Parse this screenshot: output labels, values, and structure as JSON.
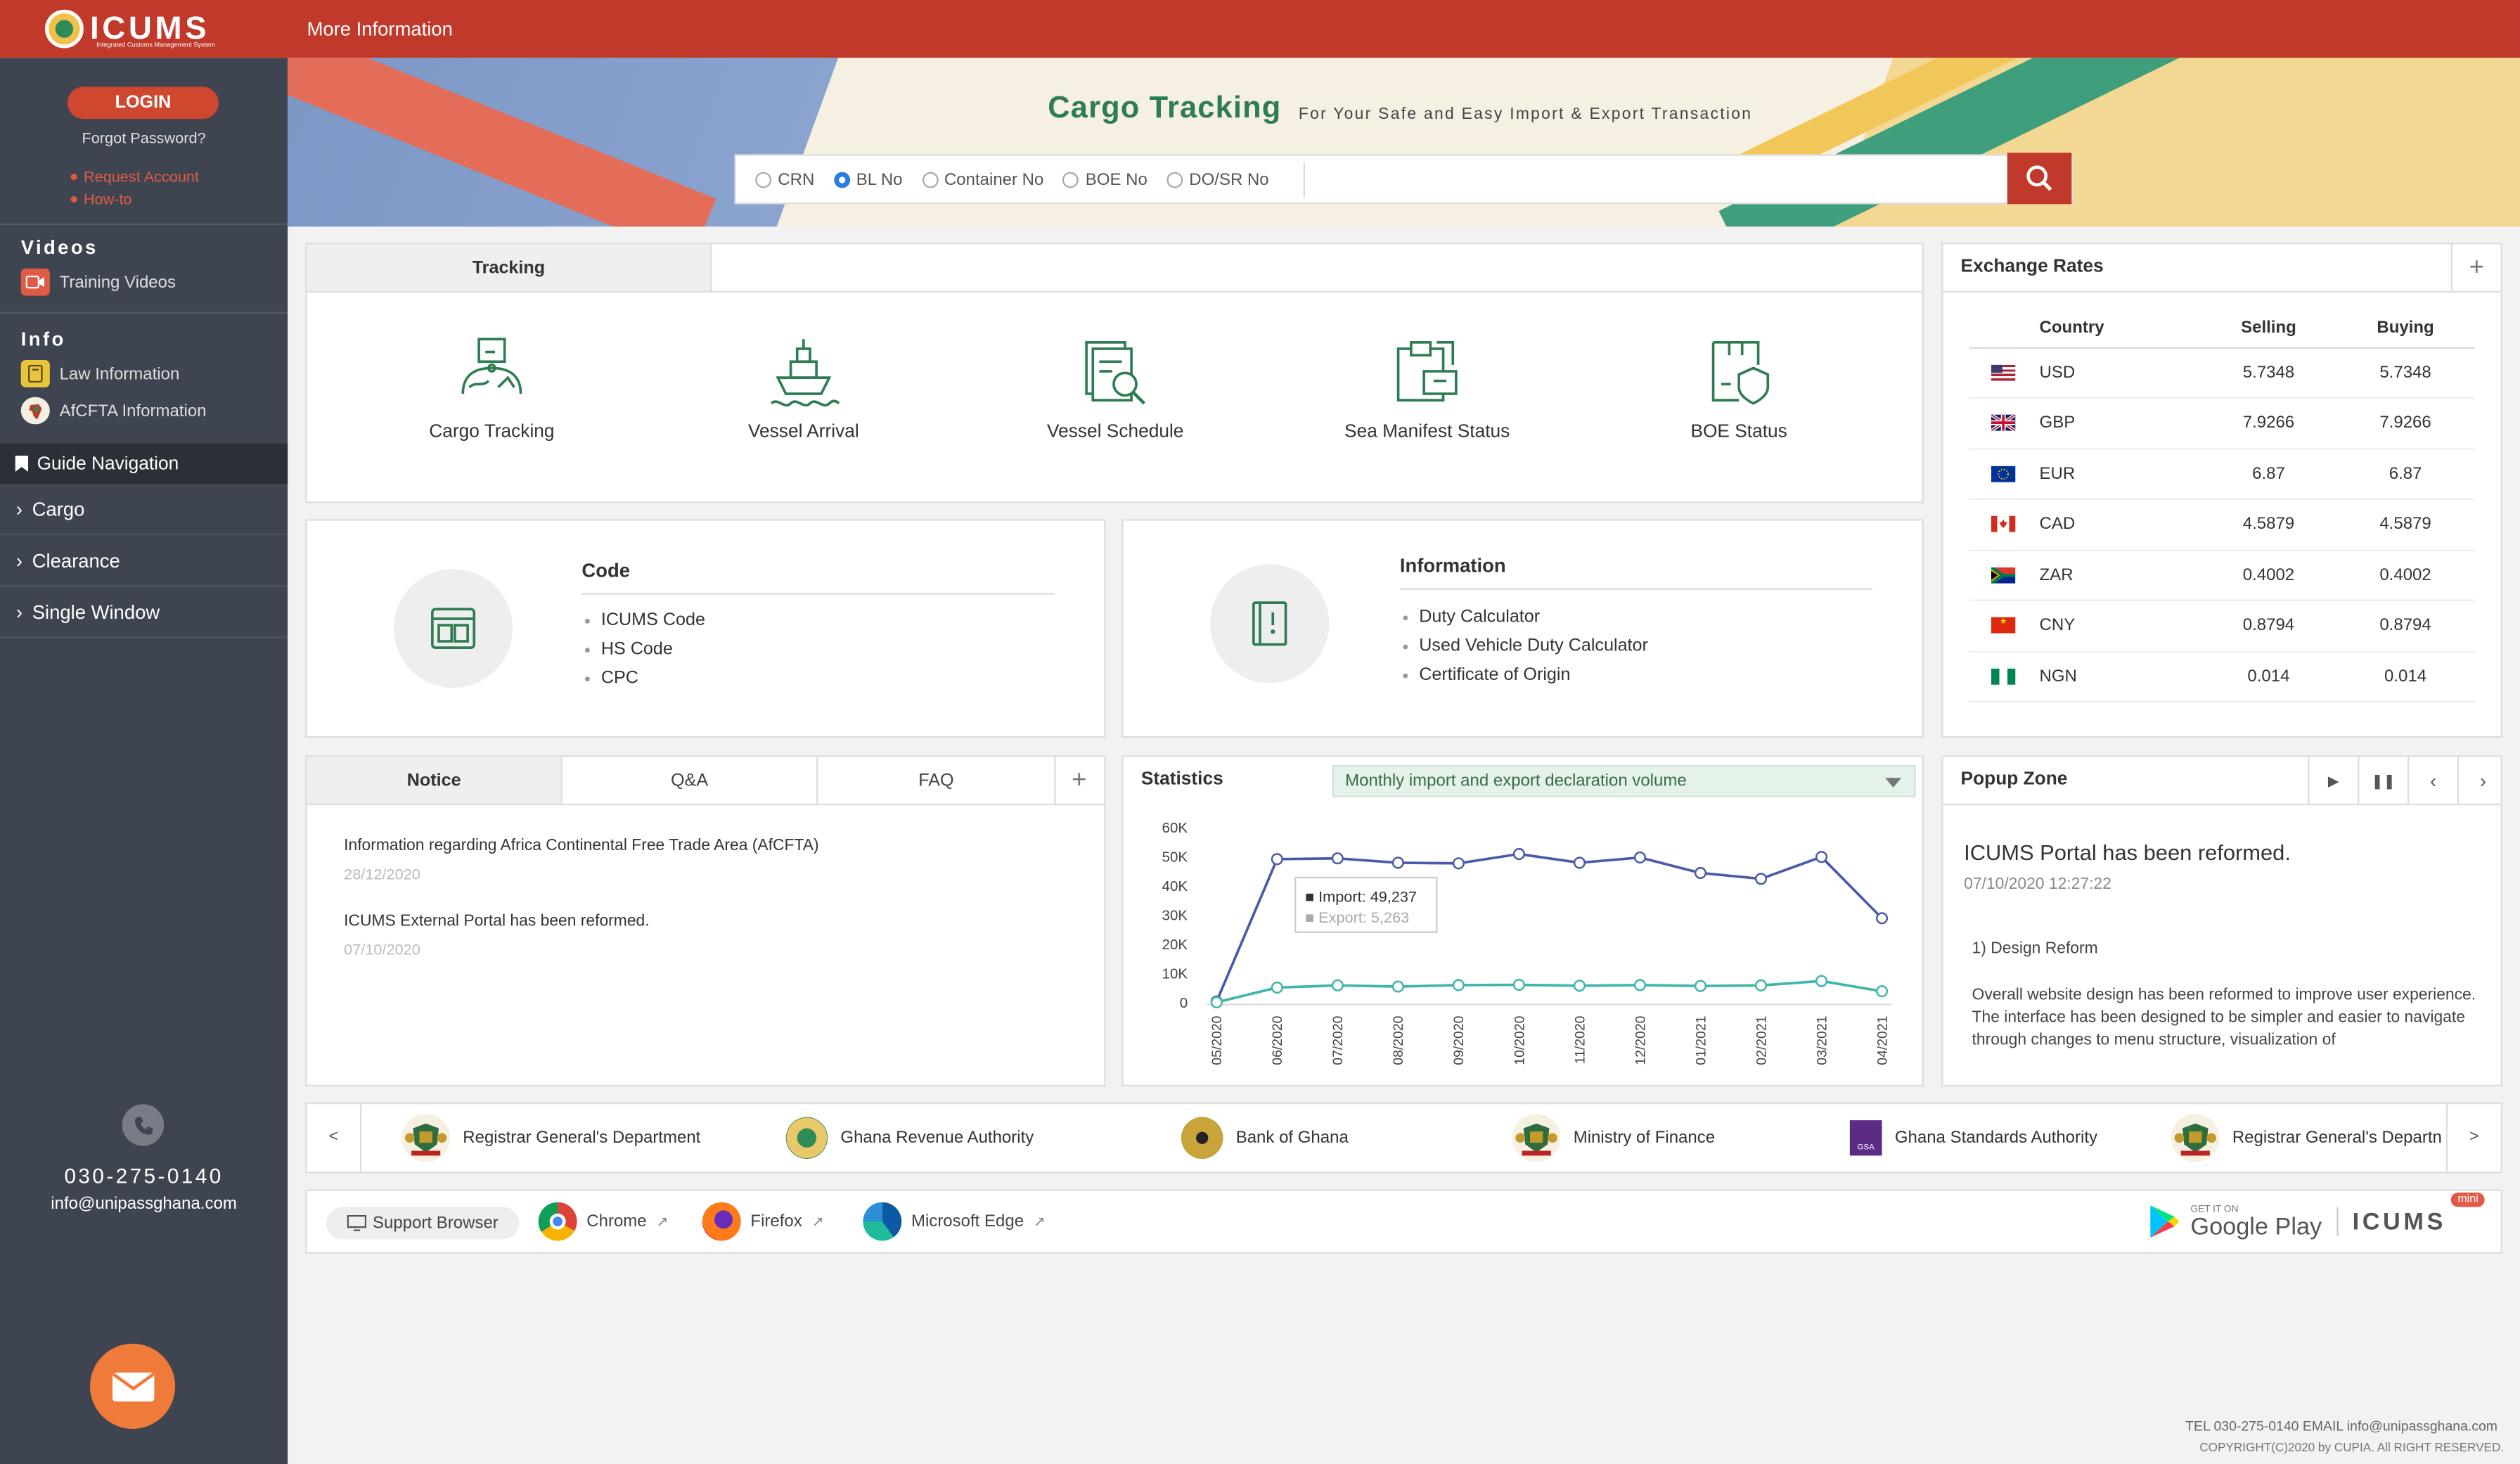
{
  "header": {
    "logo_text": "ICUMS",
    "logo_sub": "Integrated Customs Management System",
    "more_info": "More Information"
  },
  "sidebar": {
    "login": "LOGIN",
    "forgot": "Forgot Password?",
    "links": [
      "Request Account",
      "How-to"
    ],
    "videos_head": "Videos",
    "videos_items": [
      "Training Videos"
    ],
    "info_head": "Info",
    "info_items": [
      "Law Information",
      "AfCFTA Information"
    ],
    "guide": "Guide Navigation",
    "nav": [
      "Cargo",
      "Clearance",
      "Single Window"
    ],
    "phone": "030-275-0140",
    "email": "info@unipassghana.com"
  },
  "banner": {
    "title": "Cargo Tracking",
    "subtitle": "For Your Safe and Easy Import & Export Transaction",
    "radios": [
      "CRN",
      "BL No",
      "Container No",
      "BOE No",
      "DO/SR No"
    ],
    "selected": "BL No"
  },
  "tracking": {
    "tab": "Tracking",
    "items": [
      "Cargo Tracking",
      "Vessel Arrival",
      "Vessel Schedule",
      "Sea Manifest Status",
      "BOE Status"
    ]
  },
  "code": {
    "title": "Code",
    "items": [
      "ICUMS Code",
      "HS Code",
      "CPC"
    ]
  },
  "information": {
    "title": "Information",
    "items": [
      "Duty Calculator",
      "Used Vehicle Duty Calculator",
      "Certificate of Origin"
    ]
  },
  "exchange": {
    "title": "Exchange Rates",
    "headers": [
      "Country",
      "Selling",
      "Buying"
    ],
    "rows": [
      {
        "code": "USD",
        "selling": "5.7348",
        "buying": "5.7348"
      },
      {
        "code": "GBP",
        "selling": "7.9266",
        "buying": "7.9266"
      },
      {
        "code": "EUR",
        "selling": "6.87",
        "buying": "6.87"
      },
      {
        "code": "CAD",
        "selling": "4.5879",
        "buying": "4.5879"
      },
      {
        "code": "ZAR",
        "selling": "0.4002",
        "buying": "0.4002"
      },
      {
        "code": "CNY",
        "selling": "0.8794",
        "buying": "0.8794"
      },
      {
        "code": "NGN",
        "selling": "0.014",
        "buying": "0.014"
      }
    ]
  },
  "notice": {
    "tabs": [
      "Notice",
      "Q&A",
      "FAQ"
    ],
    "items": [
      {
        "title": "Information regarding Africa Continental Free Trade Area (AfCFTA)",
        "date": "28/12/2020"
      },
      {
        "title": "ICUMS External Portal has been reformed.",
        "date": "07/10/2020"
      }
    ]
  },
  "statistics": {
    "title": "Statistics",
    "select": "Monthly import and export declaration volume",
    "tooltip_import": "Import: 49,237",
    "tooltip_export": "Export: 5,263"
  },
  "chart_data": {
    "type": "line",
    "x": [
      "05/2020",
      "06/2020",
      "07/2020",
      "08/2020",
      "09/2020",
      "10/2020",
      "11/2020",
      "12/2020",
      "01/2021",
      "02/2021",
      "03/2021",
      "04/2021"
    ],
    "series": [
      {
        "name": "Import",
        "values": [
          500,
          49237,
          49500,
          48000,
          47800,
          51000,
          48000,
          49800,
          44500,
          42500,
          50000,
          29000
        ],
        "color": "#4a5aa8"
      },
      {
        "name": "Export",
        "values": [
          200,
          5263,
          6000,
          5600,
          6100,
          6200,
          5900,
          6100,
          5800,
          6000,
          7500,
          4000
        ],
        "color": "#3fb6a8"
      }
    ],
    "yticks": [
      "60K",
      "50K",
      "40K",
      "30K",
      "20K",
      "10K",
      "0"
    ],
    "ylim": [
      0,
      60000
    ]
  },
  "popup": {
    "title": "Popup Zone",
    "heading": "ICUMS Portal has been reformed.",
    "date": "07/10/2020 12:27:22",
    "section": "1) Design Reform",
    "body": "Overall website design has been reformed to improve user experience. The interface has been designed to be simpler and easier to navigate through changes to menu structure, visualization of"
  },
  "partners": [
    "Registrar General's Department",
    "Ghana Revenue Authority",
    "Bank of Ghana",
    "Ministry of Finance",
    "Ghana Standards Authority",
    "Registrar General's Departn"
  ],
  "browsers": {
    "support": "Support Browser",
    "items": [
      "Chrome",
      "Firefox",
      "Microsoft Edge"
    ],
    "gplay_small": "GET IT ON",
    "gplay": "Google Play",
    "icums_mini": "ICUMS",
    "mini": "mini"
  },
  "footer": {
    "line1": "TEL  030-275-0140  EMAIL  info@unipassghana.com",
    "line2": "COPYRIGHT(C)2020 by CUPIA. All RIGHT RESERVED."
  }
}
